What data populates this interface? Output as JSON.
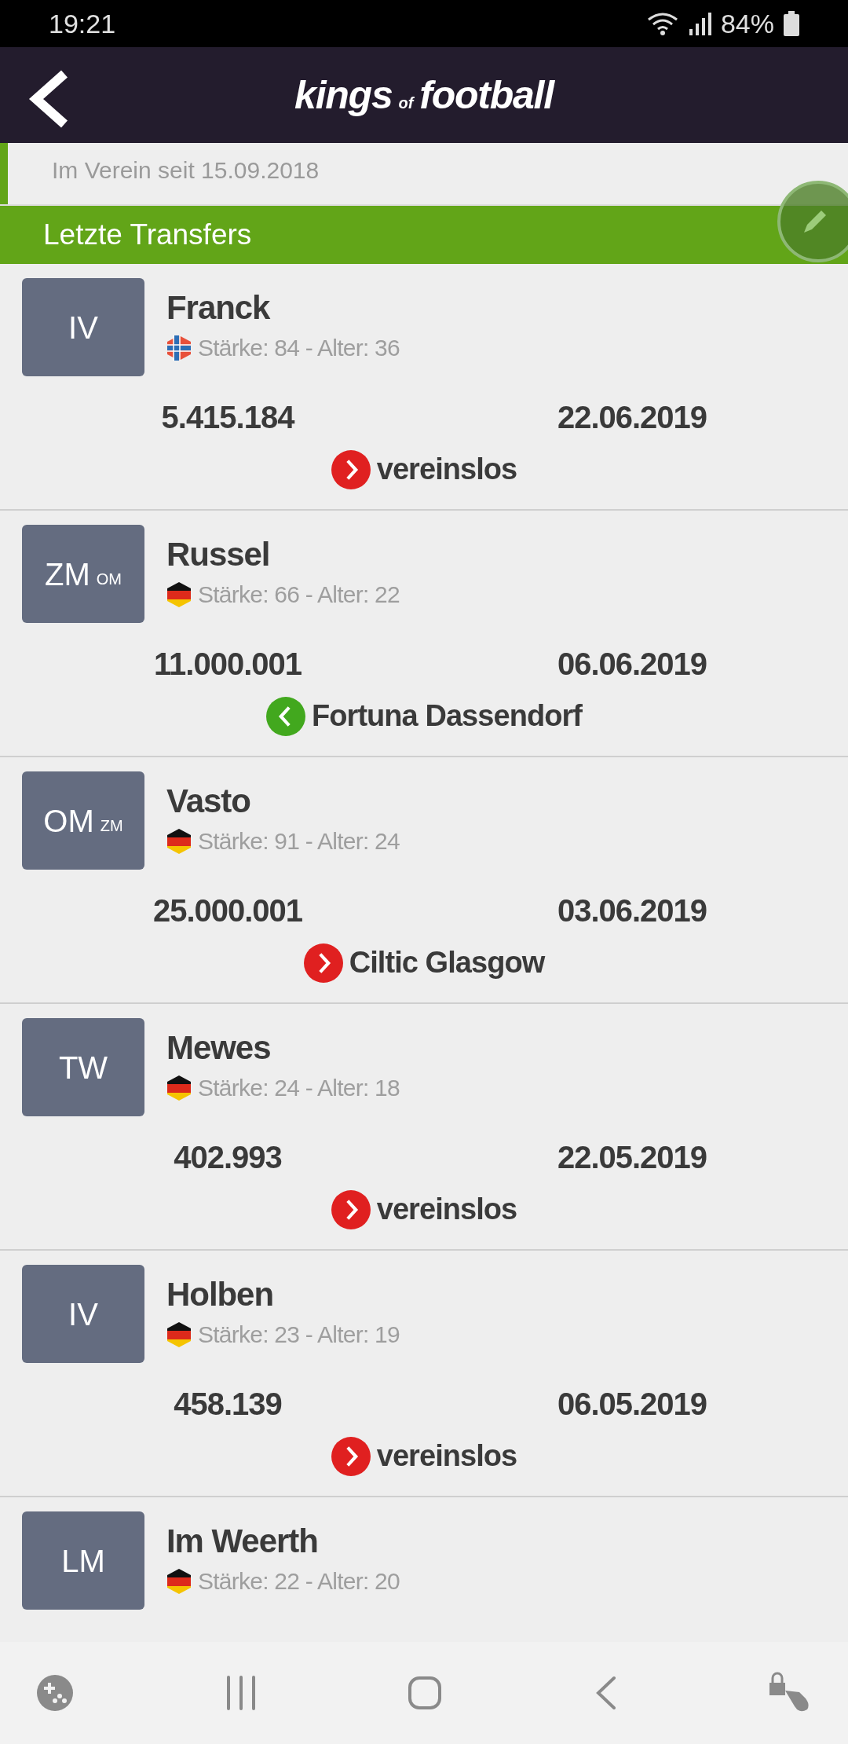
{
  "status_bar": {
    "time": "19:21",
    "battery": "84%"
  },
  "header": {
    "logo_main": "kings",
    "logo_small": "of",
    "logo_end": "football"
  },
  "club_info": {
    "since": "Im Verein seit 15.09.2018"
  },
  "section": {
    "title": "Letzte Transfers"
  },
  "transfers": [
    {
      "position": "IV",
      "name": "Franck",
      "flag": {
        "kind": "norway"
      },
      "stats": "Stärke: 84 - Alter: 36",
      "amount": "5.415.184",
      "date": "22.06.2019",
      "destination": {
        "kind": "out",
        "club": "vereinslos"
      }
    },
    {
      "position": "ZM",
      "position_secondary": "OM",
      "name": "Russel",
      "flag": {
        "kind": "germany"
      },
      "stats": "Stärke: 66 - Alter: 22",
      "amount": "11.000.001",
      "date": "06.06.2019",
      "destination": {
        "kind": "in",
        "club": "Fortuna Dassendorf"
      }
    },
    {
      "position": "OM",
      "position_secondary": "ZM",
      "name": "Vasto",
      "flag": {
        "kind": "germany"
      },
      "stats": "Stärke: 91 - Alter: 24",
      "amount": "25.000.001",
      "date": "03.06.2019",
      "destination": {
        "kind": "out",
        "club": "Ciltic Glasgow"
      }
    },
    {
      "position": "TW",
      "name": "Mewes",
      "flag": {
        "kind": "germany"
      },
      "stats": "Stärke: 24 - Alter: 18",
      "amount": "402.993",
      "date": "22.05.2019",
      "destination": {
        "kind": "out",
        "club": "vereinslos"
      }
    },
    {
      "position": "IV",
      "name": "Holben",
      "flag": {
        "kind": "germany"
      },
      "stats": "Stärke: 23 - Alter: 19",
      "amount": "458.139",
      "date": "06.05.2019",
      "destination": {
        "kind": "out",
        "club": "vereinslos"
      }
    },
    {
      "position": "LM",
      "name": "Im Weerth",
      "flag": {
        "kind": "germany"
      },
      "stats": "Stärke: 22 - Alter: 20"
    }
  ]
}
